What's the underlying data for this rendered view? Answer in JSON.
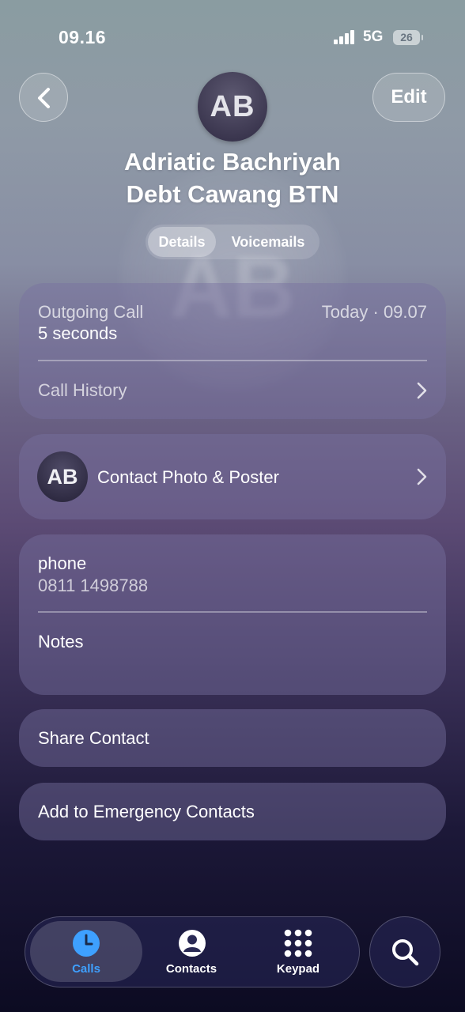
{
  "status_bar": {
    "time": "09.16",
    "network": "5G",
    "battery": "26"
  },
  "header": {
    "edit_label": "Edit",
    "avatar_initials": "AB",
    "name_line1": "Adriatic Bachriyah",
    "name_line2": "Debt Cawang BTN"
  },
  "segments": {
    "details": "Details",
    "voicemails": "Voicemails"
  },
  "call_card": {
    "call_type": "Outgoing Call",
    "duration": "5 seconds",
    "timestamp": "Today · 09.07",
    "history_label": "Call History"
  },
  "photo_card": {
    "initials": "AB",
    "label": "Contact Photo & Poster"
  },
  "info_card": {
    "phone_label": "phone",
    "phone_number": "0811 1498788",
    "notes_label": "Notes"
  },
  "actions": {
    "share": "Share Contact",
    "emergency": "Add to Emergency Contacts"
  },
  "tab_bar": {
    "calls": "Calls",
    "contacts": "Contacts",
    "keypad": "Keypad",
    "active_color": "#3ea0ff"
  }
}
